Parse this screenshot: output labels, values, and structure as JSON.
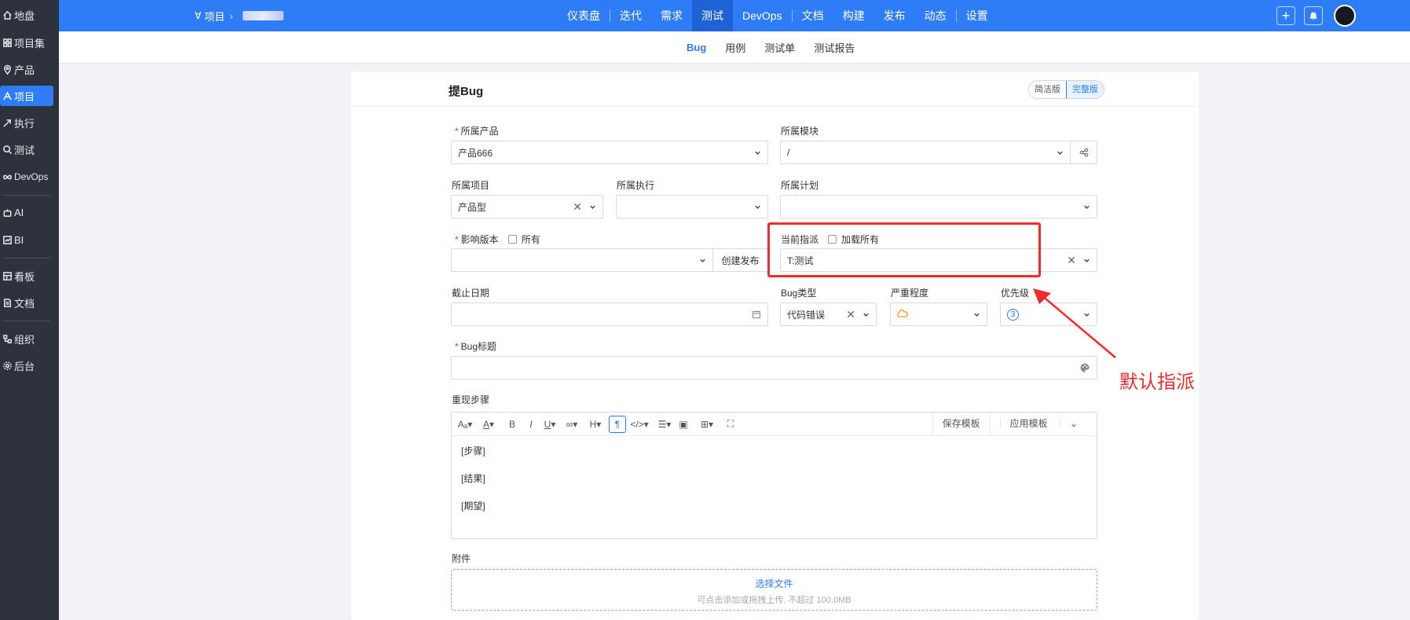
{
  "sidebar": {
    "items": [
      {
        "label": "地盘",
        "icon": "home-icon"
      },
      {
        "label": "项目集",
        "icon": "grid-icon"
      },
      {
        "label": "产品",
        "icon": "location-icon"
      },
      {
        "label": "项目",
        "icon": "project-icon",
        "active": true
      },
      {
        "label": "执行",
        "icon": "rocket-icon"
      },
      {
        "label": "测试",
        "icon": "search-icon"
      },
      {
        "label": "DevOps",
        "icon": "infinity-icon"
      },
      {
        "label": "AI",
        "icon": "robot-icon"
      },
      {
        "label": "BI",
        "icon": "chart-icon"
      },
      {
        "label": "看板",
        "icon": "board-icon"
      },
      {
        "label": "文档",
        "icon": "document-icon"
      },
      {
        "label": "组织",
        "icon": "org-icon"
      },
      {
        "label": "后台",
        "icon": "gear-icon"
      }
    ]
  },
  "topbar": {
    "breadcrumb_root": "项目",
    "nav": [
      "仪表盘",
      "迭代",
      "需求",
      "测试",
      "DevOps",
      "文档",
      "构建",
      "发布",
      "动态",
      "设置"
    ],
    "active_nav": "测试"
  },
  "subnav": {
    "items": [
      "Bug",
      "用例",
      "测试单",
      "测试报告"
    ],
    "active": "Bug"
  },
  "form": {
    "title": "提Bug",
    "mode_simple": "简洁版",
    "mode_full": "完整版",
    "product_label": "所属产品",
    "product_value": "产品666",
    "module_label": "所属模块",
    "module_value": "/",
    "project_label": "所属项目",
    "project_value": "产品型",
    "execution_label": "所属执行",
    "plan_label": "所属计划",
    "version_label": "影响版本",
    "version_all": "所有",
    "create_release": "创建发布",
    "assign_label": "当前指派",
    "assign_load_all": "加载所有",
    "assign_value": "T:测试",
    "deadline_label": "截止日期",
    "bugtype_label": "Bug类型",
    "bugtype_value": "代码错误",
    "severity_label": "严重程度",
    "priority_label": "优先级",
    "priority_value": "3",
    "title_label": "Bug标题",
    "steps_label": "重现步骤",
    "save_template": "保存模板",
    "apply_template": "应用模板",
    "steps": [
      "[步骤]",
      "[结果]",
      "[期望]"
    ],
    "attachment_label": "附件",
    "upload_title": "选择文件",
    "upload_hint": "可点击添加或拖拽上传, 不超过 100.0MB"
  },
  "annotation": {
    "text": "默认指派",
    "color": "#f02b2b"
  },
  "colors": {
    "primary": "#2e7cf6",
    "sidebar_bg": "#2e323c"
  }
}
